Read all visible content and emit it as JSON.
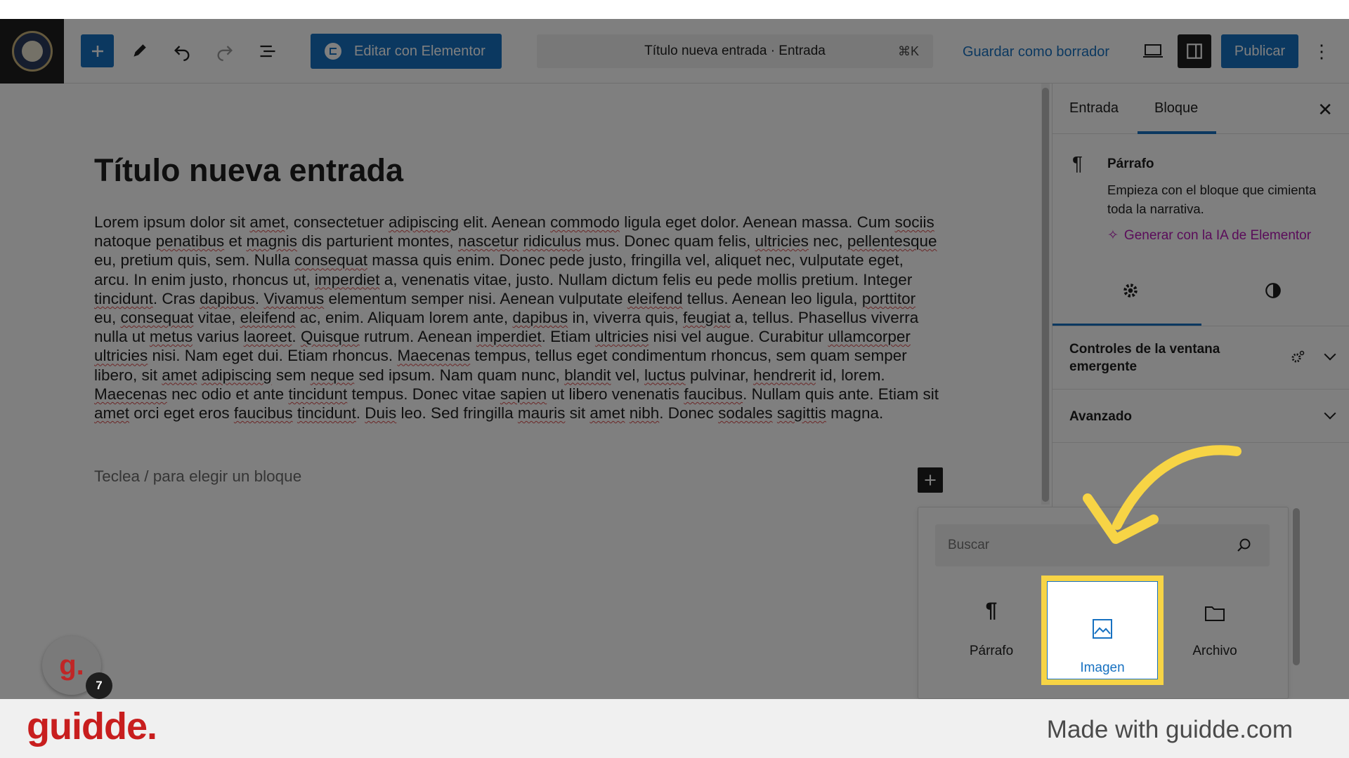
{
  "toolbar": {
    "elementor_label": "Editar con Elementor",
    "doc_title": "Título nueva entrada · Entrada",
    "doc_shortcut": "⌘K",
    "draft_label": "Guardar como borrador",
    "publish_label": "Publicar",
    "more_label": "⋮"
  },
  "post": {
    "title": "Título nueva entrada",
    "placeholder": "Teclea / para elegir un bloque"
  },
  "sidebar": {
    "tabs": [
      "Entrada",
      "Bloque"
    ],
    "active_tab": "Bloque",
    "close_label": "✕",
    "block": {
      "title": "Párrafo",
      "description": "Empieza con el bloque que cimienta toda la narrativa.",
      "ai_link": "Generar con la IA de Elementor"
    },
    "panels": [
      {
        "title": "Controles de la ventana emergente"
      },
      {
        "title": "Avanzado"
      }
    ]
  },
  "inserter": {
    "search_placeholder": "Buscar",
    "items": [
      {
        "label": "Párrafo",
        "icon": "paragraph-icon"
      },
      {
        "label": "Imagen",
        "icon": "image-icon",
        "selected": true
      },
      {
        "label": "Archivo",
        "icon": "folder-icon"
      }
    ]
  },
  "guidde": {
    "avatar_letter": "g.",
    "step_count": "7",
    "footer_logo": "guidde.",
    "footer_made": "Made with guidde.com"
  },
  "colors": {
    "accent": "#1771c1",
    "highlight": "#f7d445",
    "ai_link": "#b519b5",
    "brand_red": "#c81e1e"
  }
}
